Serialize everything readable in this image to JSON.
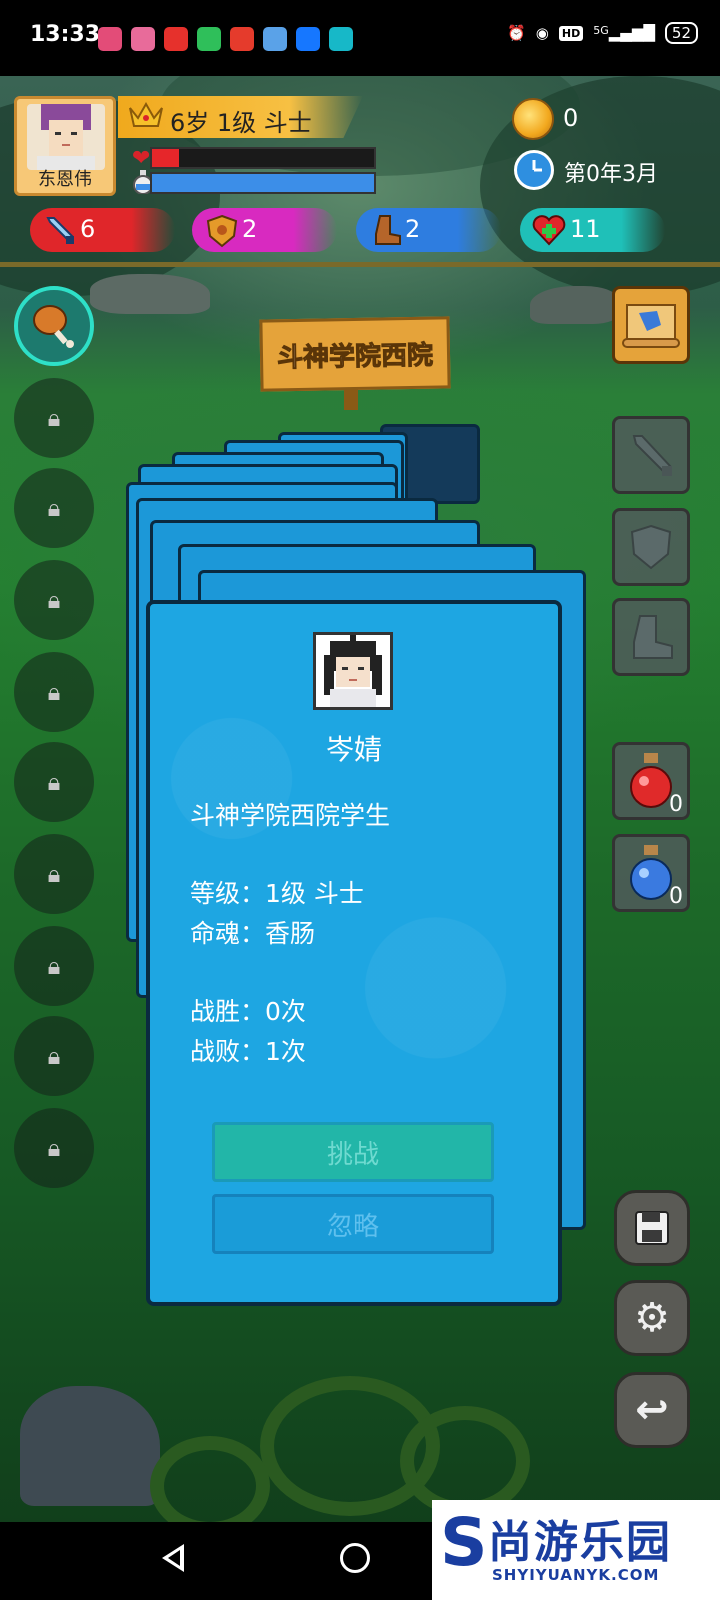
{
  "status_bar": {
    "time": "13:33",
    "network": "5G",
    "hd": "HD",
    "battery": "52"
  },
  "player": {
    "name": "东恩伟",
    "rank": "6岁 1级 斗士",
    "hp_ratio": 0.12,
    "mp_ratio": 1.0,
    "coins": "0",
    "date": "第0年3月"
  },
  "stats": {
    "attack": "6",
    "defense": "2",
    "speed": "2",
    "health": "11"
  },
  "location": {
    "sign": "斗神学院西院"
  },
  "encounter": {
    "name": "岑婧",
    "title": "斗神学院西院学生",
    "level_label": "等级：",
    "level_value": "1级 斗士",
    "soul_label": "命魂：",
    "soul_value": "香肠",
    "wins_label": "战胜：",
    "wins_value": "0次",
    "losses_label": "战败：",
    "losses_value": "1次",
    "challenge_button": "挑战",
    "ignore_button": "忽略"
  },
  "inventory": {
    "red_potion_count": "0",
    "blue_potion_count": "0"
  },
  "watermark": {
    "brand_letter": "S",
    "brand_cn": "尚游乐园",
    "brand_en": "SHYIYUANYK.COM"
  },
  "colors": {
    "card": "#1ea6e2",
    "attack": "#e0262a",
    "defense": "#d82ac0",
    "speed": "#2e7de0",
    "health": "#1fc0b8"
  }
}
